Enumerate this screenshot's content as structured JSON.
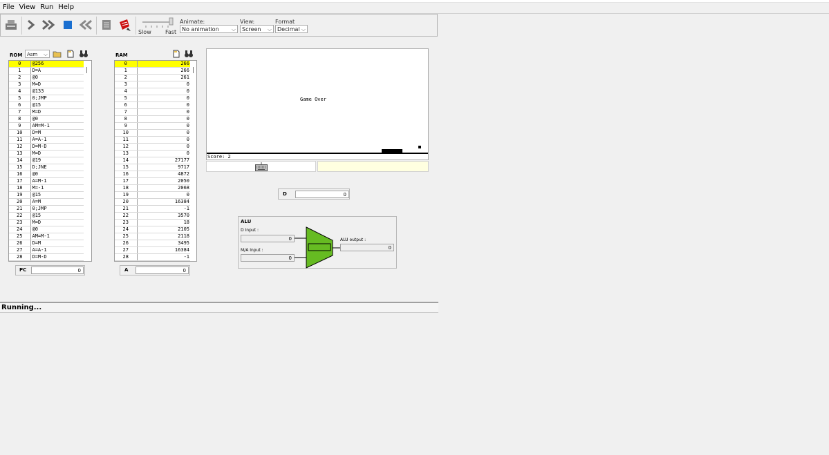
{
  "menu": {
    "file": "File",
    "view": "View",
    "run": "Run",
    "help": "Help"
  },
  "toolbar": {
    "slow": "Slow",
    "fast": "Fast",
    "animate_label": "Animate:",
    "animate_value": "No animation",
    "view_label": "View:",
    "view_value": "Screen",
    "format_label": "Format",
    "format_value": "Decimal"
  },
  "rom": {
    "title": "ROM",
    "mode": "Asm",
    "rows": [
      [
        "0",
        "@256"
      ],
      [
        "1",
        "D=A"
      ],
      [
        "2",
        "@0"
      ],
      [
        "3",
        "M=D"
      ],
      [
        "4",
        "@133"
      ],
      [
        "5",
        "0;JMP"
      ],
      [
        "6",
        "@15"
      ],
      [
        "7",
        "M=D"
      ],
      [
        "8",
        "@0"
      ],
      [
        "9",
        "AM=M-1"
      ],
      [
        "10",
        "D=M"
      ],
      [
        "11",
        "A=A-1"
      ],
      [
        "12",
        "D=M-D"
      ],
      [
        "13",
        "M=D"
      ],
      [
        "14",
        "@19"
      ],
      [
        "15",
        "D;JNE"
      ],
      [
        "16",
        "@0"
      ],
      [
        "17",
        "A=M-1"
      ],
      [
        "18",
        "M=-1"
      ],
      [
        "19",
        "@15"
      ],
      [
        "20",
        "A=M"
      ],
      [
        "21",
        "0;JMP"
      ],
      [
        "22",
        "@15"
      ],
      [
        "23",
        "M=D"
      ],
      [
        "24",
        "@0"
      ],
      [
        "25",
        "AM=M-1"
      ],
      [
        "26",
        "D=M"
      ],
      [
        "27",
        "A=A-1"
      ],
      [
        "28",
        "D=M-D"
      ]
    ]
  },
  "ram": {
    "title": "RAM",
    "rows": [
      [
        "0",
        "266"
      ],
      [
        "1",
        "266"
      ],
      [
        "2",
        "261"
      ],
      [
        "3",
        "0"
      ],
      [
        "4",
        "0"
      ],
      [
        "5",
        "0"
      ],
      [
        "6",
        "0"
      ],
      [
        "7",
        "0"
      ],
      [
        "8",
        "0"
      ],
      [
        "9",
        "0"
      ],
      [
        "10",
        "0"
      ],
      [
        "11",
        "0"
      ],
      [
        "12",
        "0"
      ],
      [
        "13",
        "0"
      ],
      [
        "14",
        "27177"
      ],
      [
        "15",
        "9717"
      ],
      [
        "16",
        "4872"
      ],
      [
        "17",
        "2050"
      ],
      [
        "18",
        "2068"
      ],
      [
        "19",
        "0"
      ],
      [
        "20",
        "16384"
      ],
      [
        "21",
        "-1"
      ],
      [
        "22",
        "3570"
      ],
      [
        "23",
        "18"
      ],
      [
        "24",
        "2105"
      ],
      [
        "25",
        "2118"
      ],
      [
        "26",
        "3495"
      ],
      [
        "27",
        "16384"
      ],
      [
        "28",
        "-1"
      ]
    ]
  },
  "screen": {
    "message": "Game Over",
    "score": "Score: 2"
  },
  "registers": {
    "pc_label": "PC",
    "pc_value": "0",
    "a_label": "A",
    "a_value": "0",
    "d_label": "D",
    "d_value": "0"
  },
  "alu": {
    "title": "ALU",
    "d_input_label": "D Input :",
    "d_input_value": "0",
    "ma_input_label": "M/A Input :",
    "ma_input_value": "0",
    "output_label": "ALU output :",
    "output_value": "0",
    "fill_color": "#66bb22"
  },
  "status": "Running..."
}
